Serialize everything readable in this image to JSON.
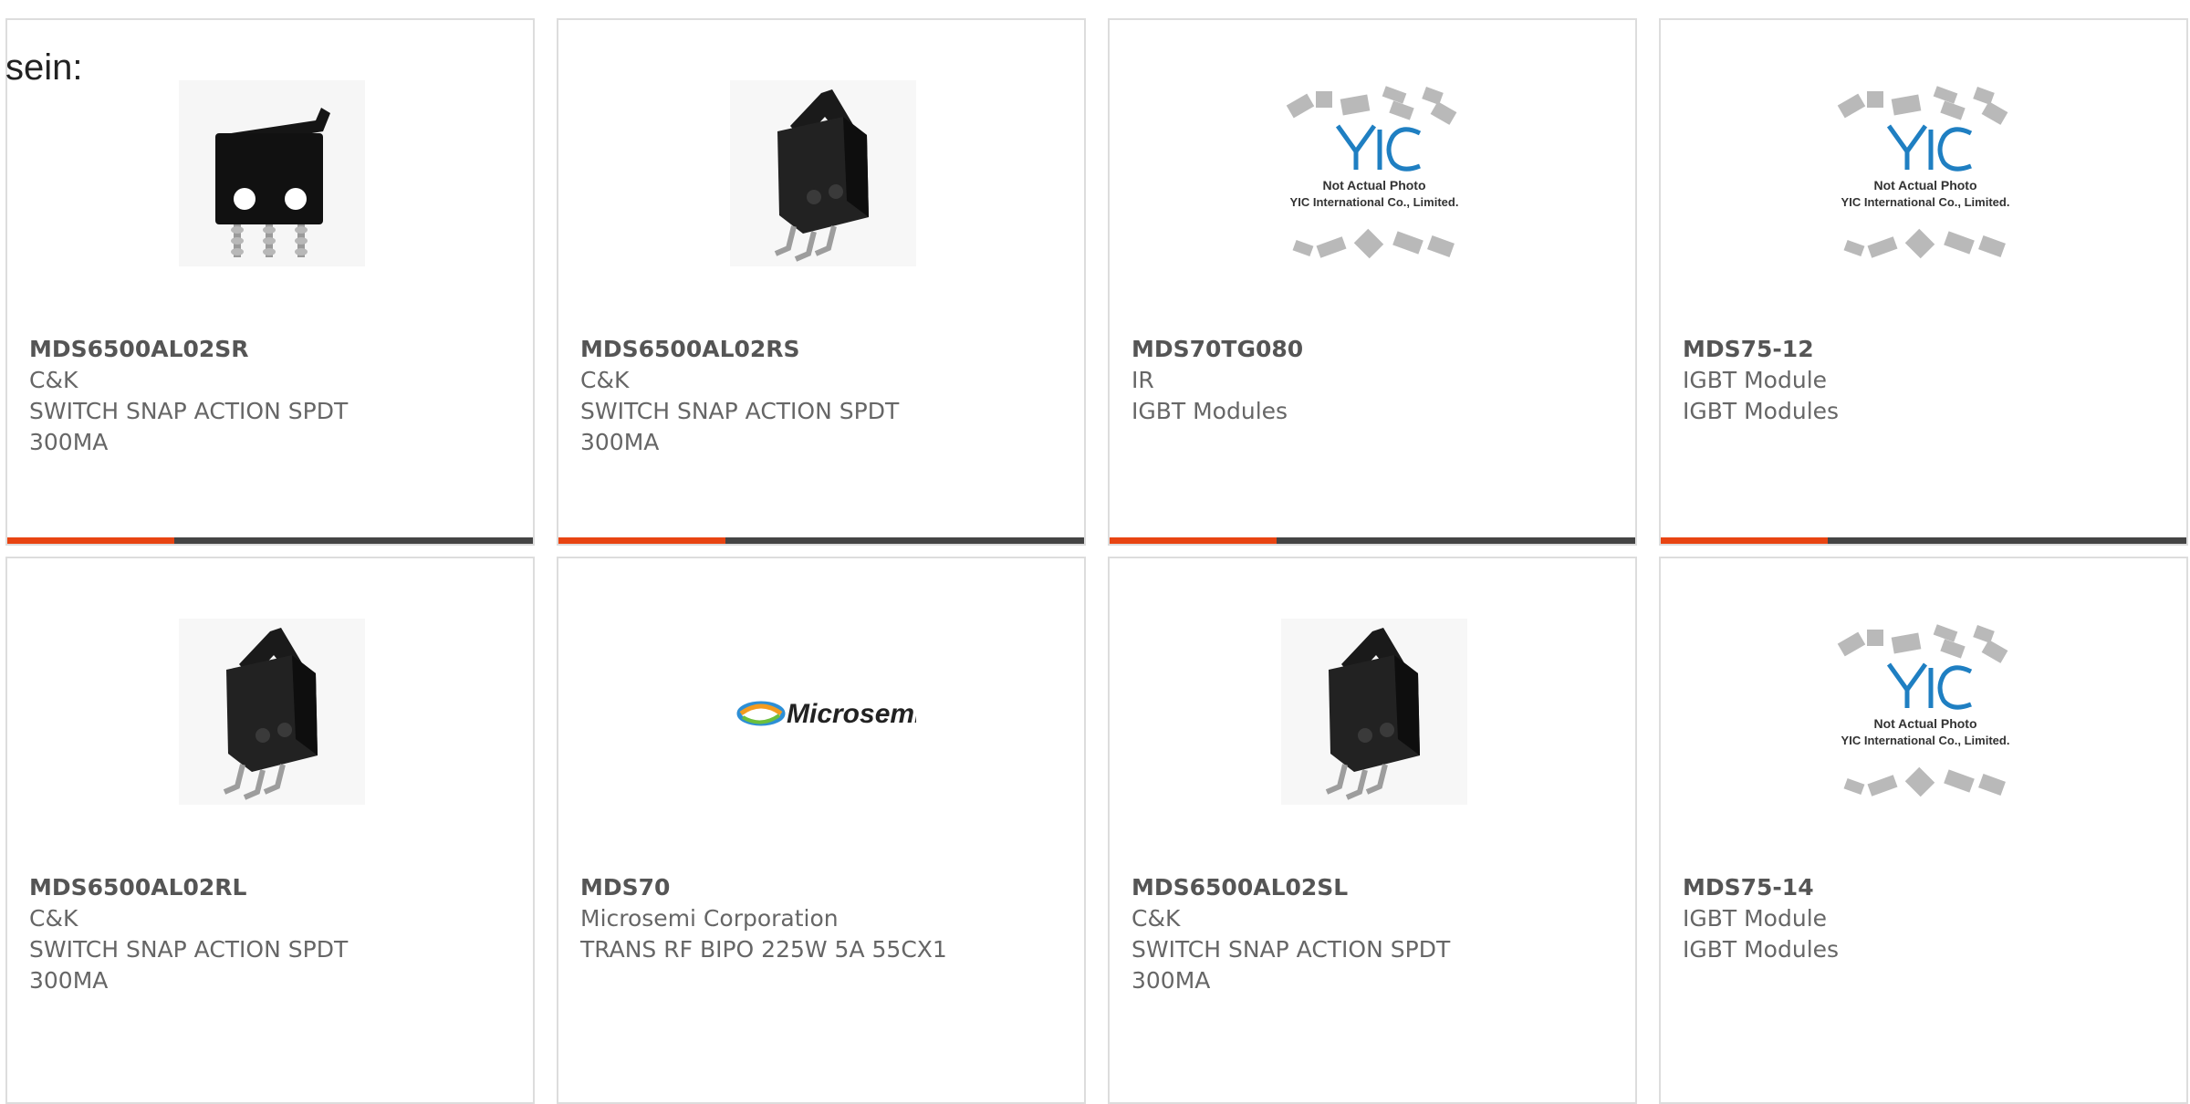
{
  "intro_text": "sein:",
  "colors": {
    "accent": "#e84412",
    "bar": "#444444",
    "border": "#dddddd",
    "text": "#666666"
  },
  "products": [
    {
      "part": "MDS6500AL02SR",
      "brand": "C&K",
      "desc1": "SWITCH SNAP ACTION SPDT",
      "desc2": "300MA",
      "image": "snap-switch-lever-front"
    },
    {
      "part": "MDS6500AL02RS",
      "brand": "C&K",
      "desc1": "SWITCH SNAP ACTION SPDT",
      "desc2": "300MA",
      "image": "snap-switch-angled"
    },
    {
      "part": "MDS70TG080",
      "brand": "IR",
      "desc1": "IGBT Modules",
      "desc2": "",
      "image": "yic-placeholder",
      "placeholder_line1": "Not Actual Photo",
      "placeholder_line2": "YIC International Co., Limited."
    },
    {
      "part": "MDS75-12",
      "brand": "IGBT Module",
      "desc1": "IGBT Modules",
      "desc2": "",
      "image": "yic-placeholder",
      "placeholder_line1": "Not Actual Photo",
      "placeholder_line2": "YIC International Co., Limited."
    },
    {
      "part": "MDS6500AL02RL",
      "brand": "C&K",
      "desc1": "SWITCH SNAP ACTION SPDT",
      "desc2": "300MA",
      "image": "snap-switch-angled"
    },
    {
      "part": "MDS70",
      "brand": "Microsemi Corporation",
      "desc1": "TRANS RF BIPO 225W 5A 55CX1",
      "desc2": "",
      "image": "microsemi-logo",
      "logo_text": "Microsemi"
    },
    {
      "part": "MDS6500AL02SL",
      "brand": "C&K",
      "desc1": "SWITCH SNAP ACTION SPDT",
      "desc2": "300MA",
      "image": "snap-switch-angled"
    },
    {
      "part": "MDS75-14",
      "brand": "IGBT Module",
      "desc1": "IGBT Modules",
      "desc2": "",
      "image": "yic-placeholder",
      "placeholder_line1": "Not Actual Photo",
      "placeholder_line2": "YIC International Co., Limited."
    }
  ]
}
